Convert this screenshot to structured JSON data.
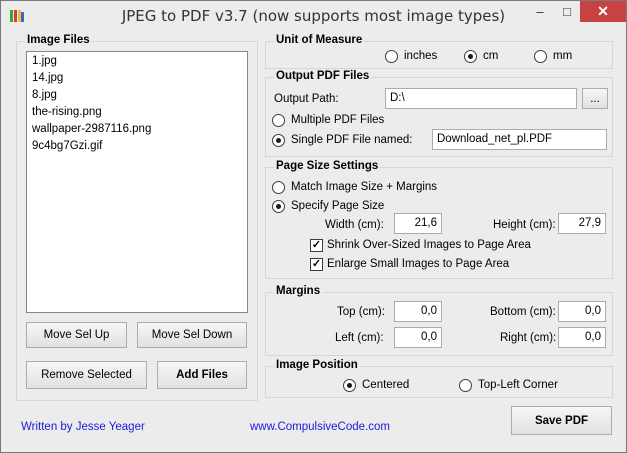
{
  "window": {
    "title": "JPEG to PDF  v3.7    (now supports most image types)",
    "minimize": "–",
    "maximize": "□",
    "close": "✕"
  },
  "image_files": {
    "title": "Image Files",
    "items": [
      "1.jpg",
      "14.jpg",
      "8.jpg",
      "the-rising.png",
      "wallpaper-2987116.png",
      "9c4bg7Gzi.gif"
    ],
    "move_up": "Move Sel Up",
    "move_down": "Move Sel Down",
    "remove_selected": "Remove Selected",
    "add_files": "Add Files"
  },
  "unit": {
    "title": "Unit of Measure",
    "options": [
      "inches",
      "cm",
      "mm"
    ],
    "selected": "cm"
  },
  "output": {
    "title": "Output PDF Files",
    "path_label": "Output Path:",
    "path_value": "D:\\",
    "browse": "...",
    "multiple_label": "Multiple PDF Files",
    "single_label": "Single PDF File named:",
    "single_value": "Download_net_pl.PDF",
    "selected": "single"
  },
  "page_size": {
    "title": "Page Size Settings",
    "match_label": "Match Image Size + Margins",
    "specify_label": "Specify Page Size",
    "selected": "specify",
    "width_label": "Width (cm):",
    "width_value": "21,6",
    "height_label": "Height (cm):",
    "height_value": "27,9",
    "shrink_label": "Shrink Over-Sized Images to Page Area",
    "enlarge_label": "Enlarge Small Images to Page Area",
    "check_mark": "✓"
  },
  "margins": {
    "title": "Margins",
    "top_label": "Top (cm):",
    "top_value": "0,0",
    "bottom_label": "Bottom (cm):",
    "bottom_value": "0,0",
    "left_label": "Left (cm):",
    "left_value": "0,0",
    "right_label": "Right (cm):",
    "right_value": "0,0"
  },
  "position": {
    "title": "Image Position",
    "centered_label": "Centered",
    "topleft_label": "Top-Left Corner",
    "selected": "centered"
  },
  "footer": {
    "author": "Written by Jesse Yeager",
    "website": "www.CompulsiveCode.com",
    "save": "Save PDF"
  },
  "colors": {
    "link": "#1a1adb",
    "close_button": "#c74343"
  }
}
